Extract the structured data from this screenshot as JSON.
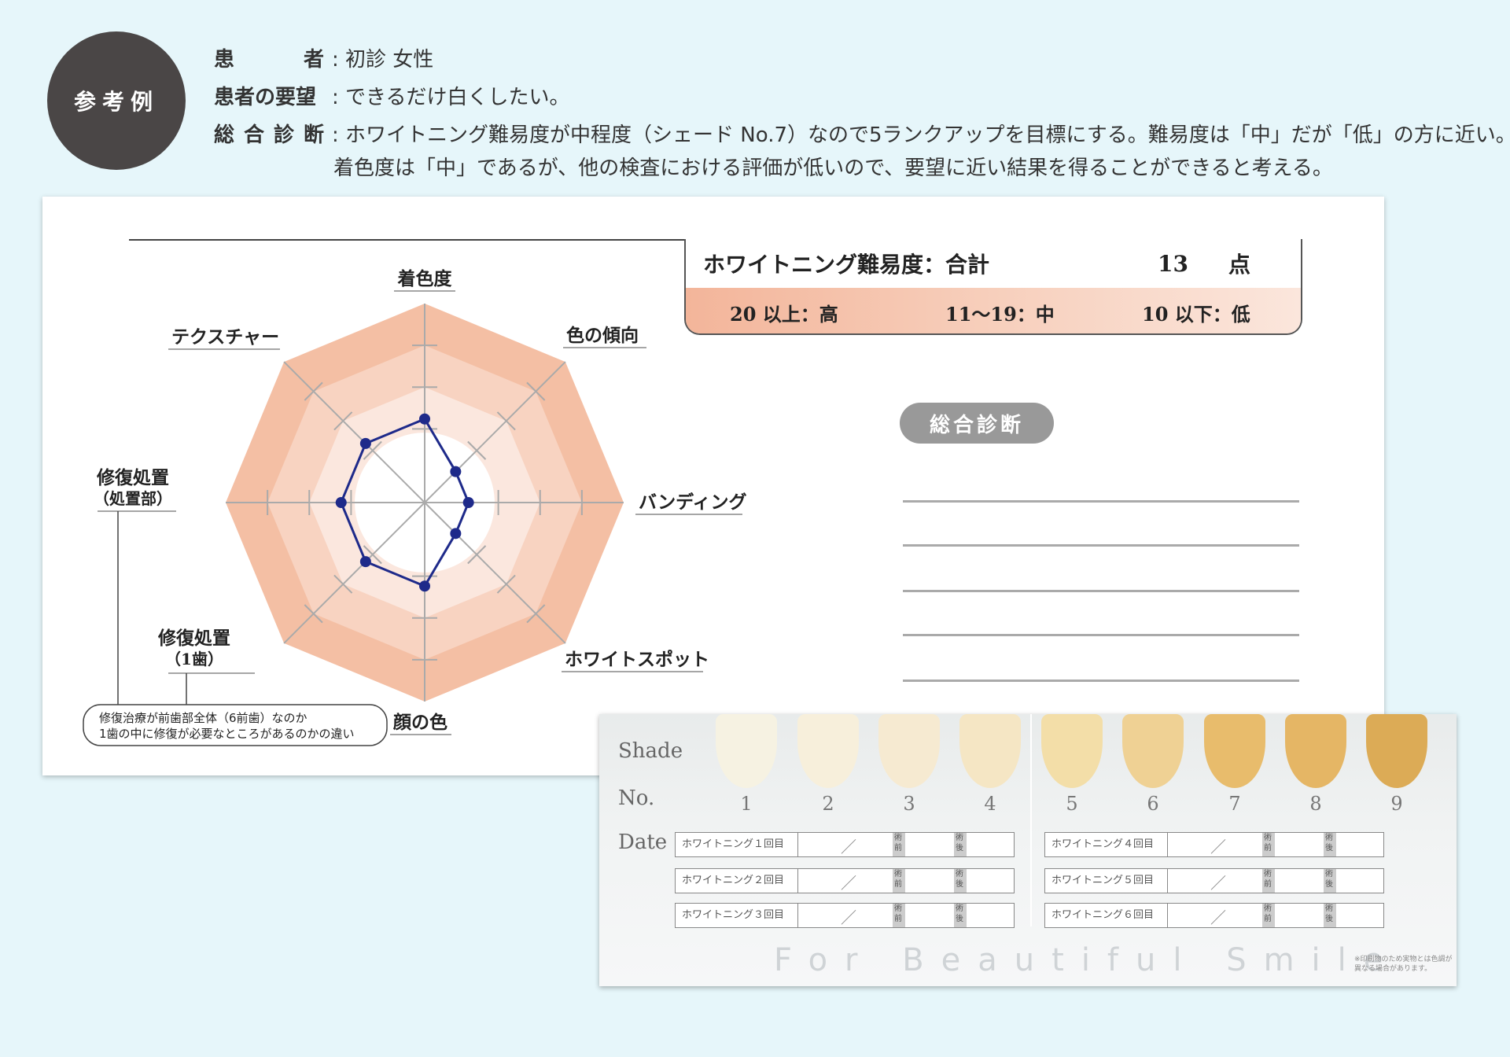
{
  "badge": "参考例",
  "info": {
    "patient_label": "患　者",
    "patient_value": "初診 女性",
    "request_label": "患者の要望",
    "request_value": "できるだけ白くしたい。",
    "diagnosis_label": "総合診断",
    "diagnosis_value_1": "ホワイトニング難易度が中程度（シェード No.7）なので5ランクアップを目標にする。難易度は「中」だが「低」の方に近い。",
    "diagnosis_value_2": "着色度は「中」であるが、他の検査における評価が低いので、要望に近い結果を得ることができると考える。"
  },
  "radar": {
    "labels": {
      "top": "着色度",
      "top_right": "色の傾向",
      "right": "バンディング",
      "bottom_right": "ホワイトスポット",
      "bottom": "顔の色",
      "bottom_left_1": "修復処置",
      "bottom_left_2": "（1歯）",
      "left_1": "修復処置",
      "left_2": "（処置部）",
      "top_left": "テクスチャー"
    },
    "note_1": "修復治療が前歯部全体（6前歯）なのか",
    "note_2": "1歯の中に修復が必要なところがあるのかの違い",
    "levels": [
      2,
      1,
      1,
      1,
      2,
      2,
      2,
      2
    ],
    "colors": {
      "outer": "#f4bfa4",
      "mid": "#f8d3c1",
      "inner": "#fbe7de",
      "line": "#1e2a8a"
    }
  },
  "score": {
    "title": "ホワイトニング難易度：合計",
    "value": "13",
    "unit": "点",
    "high": "20 以上：高",
    "mid": "11〜19：中",
    "low": "10 以下：低"
  },
  "diagnosis_pill": "総合診断",
  "shade": {
    "shade_label": "Shade",
    "no_label": "No.",
    "date_label": "Date",
    "numbers": [
      "1",
      "2",
      "3",
      "4",
      "5",
      "6",
      "7",
      "8",
      "9"
    ],
    "colors": [
      "#f6f2e2",
      "#f7efdb",
      "#f6ead1",
      "#f5e6c4",
      "#f3dea8",
      "#efd194",
      "#e8bc6c",
      "#e5b665",
      "#dcab56"
    ],
    "rows": [
      "ホワイトニング１回目",
      "ホワイトニング２回目",
      "ホワイトニング３回目",
      "ホワイトニング４回目",
      "ホワイトニング５回目",
      "ホワイトニング６回目"
    ],
    "slash": "／",
    "before": "術前",
    "after": "術後",
    "slogan": "For Beautiful Smile",
    "note": "※印刷物のため実物とは色調が異なる場合があります。"
  }
}
